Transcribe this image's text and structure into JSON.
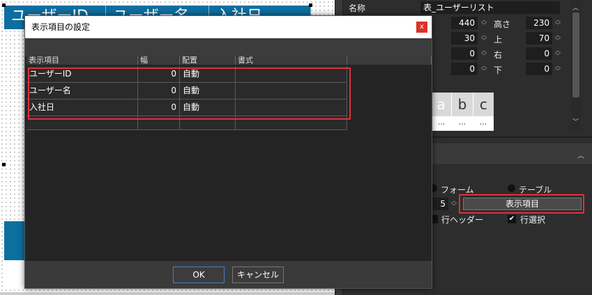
{
  "canvas": {
    "header_cells": [
      "ユーザーID",
      "ユーザー名",
      "入社日"
    ]
  },
  "panel": {
    "name_label": "名称",
    "name_value": "表_ユーザーリスト",
    "width_value": "440",
    "height_label": "高さ",
    "height_value": "230",
    "left_value": "30",
    "top_label": "上",
    "top_value": "70",
    "pad_left_value": "0",
    "right_label": "右",
    "right_value": "0",
    "pad_top_value": "0",
    "bottom_label": "下",
    "bottom_value": "0",
    "preview_cols": [
      "a",
      "b",
      "c"
    ],
    "preview_dots": "...",
    "mode_form_label": "フォーム",
    "mode_table_label": "テーブル",
    "rows_value": "5",
    "columns_button": "表示項目",
    "row_header_label": "行ヘッダー",
    "row_select_label": "行選択",
    "row_select_checked": "✔"
  },
  "dialog": {
    "title": "表示項目の設定",
    "close": "x",
    "headers": [
      "表示項目",
      "幅",
      "配置",
      "書式"
    ],
    "rows": [
      {
        "item": "ユーザーID",
        "width": "0",
        "align": "自動",
        "format": ""
      },
      {
        "item": "ユーザー名",
        "width": "0",
        "align": "自動",
        "format": ""
      },
      {
        "item": "入社日",
        "width": "0",
        "align": "自動",
        "format": ""
      }
    ],
    "ok": "OK",
    "cancel": "キャンセル"
  },
  "colors": {
    "accent": "#0d6fa0",
    "highlight": "#e0303b",
    "close": "#d9332a"
  }
}
